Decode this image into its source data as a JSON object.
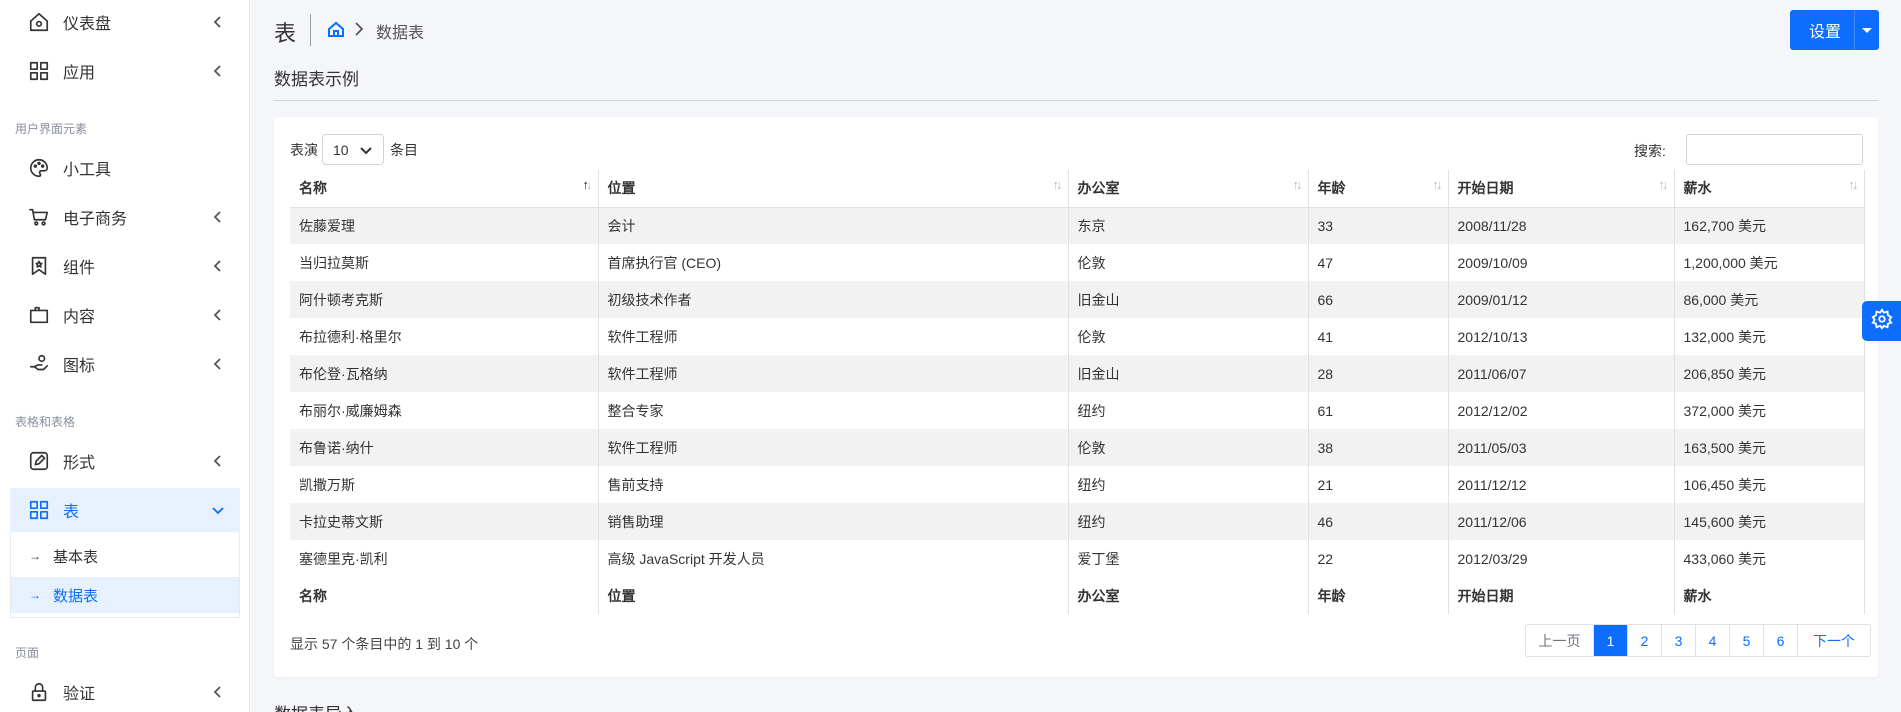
{
  "sidebar": {
    "items": [
      {
        "label": "仪表盘",
        "icon": "home-icon"
      },
      {
        "label": "应用",
        "icon": "grid-icon"
      },
      {
        "label": "小工具",
        "icon": "palette-icon"
      },
      {
        "label": "电子商务",
        "icon": "cart-icon"
      },
      {
        "label": "组件",
        "icon": "bookmark-icon"
      },
      {
        "label": "内容",
        "icon": "content-icon"
      },
      {
        "label": "图标",
        "icon": "hand-icon"
      },
      {
        "label": "形式",
        "icon": "pen-square-icon"
      },
      {
        "label": "表",
        "icon": "grid-icon"
      },
      {
        "label": "验证",
        "icon": "lock-icon"
      }
    ],
    "sections": [
      "用户界面元素",
      "表格和表格",
      "页面"
    ],
    "sub_items": [
      {
        "label": "基本表"
      },
      {
        "label": "数据表"
      }
    ]
  },
  "header": {
    "title": "表",
    "breadcrumb": "数据表",
    "settings_label": "设置"
  },
  "main": {
    "subtitle": "数据表示例",
    "bottom_heading": "数据表导入"
  },
  "table": {
    "length_label": "表演",
    "length_value": "10",
    "length_suffix": "条目",
    "search_label": "搜索:",
    "columns": [
      "名称",
      "位置",
      "办公室",
      "年龄",
      "开始日期",
      "薪水"
    ],
    "rows": [
      [
        "佐藤爱理",
        "会计",
        "东京",
        "33",
        "2008/11/28",
        "162,700 美元"
      ],
      [
        "当归拉莫斯",
        "首席执行官 (CEO)",
        "伦敦",
        "47",
        "2009/10/09",
        "1,200,000 美元"
      ],
      [
        "阿什顿考克斯",
        "初级技术作者",
        "旧金山",
        "66",
        "2009/01/12",
        "86,000 美元"
      ],
      [
        "布拉德利·格里尔",
        "软件工程师",
        "伦敦",
        "41",
        "2012/10/13",
        "132,000 美元"
      ],
      [
        "布伦登·瓦格纳",
        "软件工程师",
        "旧金山",
        "28",
        "2011/06/07",
        "206,850 美元"
      ],
      [
        "布丽尔·威廉姆森",
        "整合专家",
        "纽约",
        "61",
        "2012/12/02",
        "372,000 美元"
      ],
      [
        "布鲁诺·纳什",
        "软件工程师",
        "伦敦",
        "38",
        "2011/05/03",
        "163,500 美元"
      ],
      [
        "凯撒万斯",
        "售前支持",
        "纽约",
        "21",
        "2011/12/12",
        "106,450 美元"
      ],
      [
        "卡拉史蒂文斯",
        "销售助理",
        "纽约",
        "46",
        "2011/12/06",
        "145,600 美元"
      ],
      [
        "塞德里克·凯利",
        "高级 JavaScript 开发人员",
        "爱丁堡",
        "22",
        "2012/03/29",
        "433,060 美元"
      ]
    ],
    "info": "显示 57 个条目中的 1 到 10 个",
    "pagination": {
      "prev": "上一页",
      "pages": [
        "1",
        "2",
        "3",
        "4",
        "5",
        "6"
      ],
      "active": "1",
      "next": "下一个"
    }
  },
  "colors": {
    "accent": "#0d6efd",
    "stripe": "#f2f2f2",
    "active_bg": "#e7f0fd"
  }
}
